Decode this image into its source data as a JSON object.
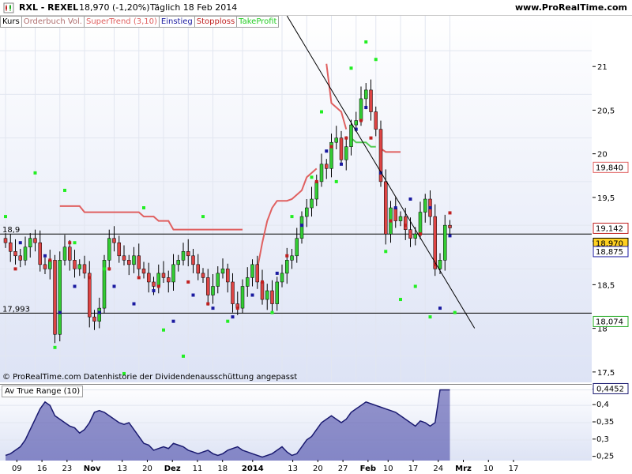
{
  "header": {
    "symbol": "RXL - REXEL",
    "price_change": "18,970 (-1,20%)",
    "period": "Täglich  18 Feb 2014",
    "site": "www.ProRealTime.com"
  },
  "legend": [
    {
      "label": "Kurs",
      "color": "#000000"
    },
    {
      "label": "Orderbuch Vol.",
      "color": "#b07070"
    },
    {
      "label": "SuperTrend (3,10)",
      "color": "#e06060"
    },
    {
      "label": "Einstieg",
      "color": "#1a1aa0"
    },
    {
      "label": "Stopploss",
      "color": "#c02020"
    },
    {
      "label": "TakeProfit",
      "color": "#22cc22"
    }
  ],
  "copyright": "© ProRealTime.com  Datenhistorie der Dividendenausschüttung angepasst",
  "atr_label": "Av True Range (10)",
  "chart_data": [
    {
      "type": "candlestick",
      "y_ticks": [
        "21",
        "20,5",
        "20",
        "19,5",
        "19",
        "18,5",
        "18",
        "17,5"
      ],
      "ylim": [
        17.2,
        21.4
      ],
      "horizontal_lines": [
        {
          "label": "18,9",
          "value": 18.9
        },
        {
          "label": "17,993",
          "value": 17.993
        }
      ],
      "price_tags": [
        {
          "label": "19,840",
          "value": 19.84,
          "color": "#e06060",
          "bg": "#ffffff"
        },
        {
          "label": "19,142",
          "value": 19.142,
          "color": "#c02020",
          "bg": "#ffffff"
        },
        {
          "label": "18,970",
          "value": 18.97,
          "color": "#000000",
          "bg": "#ffd020"
        },
        {
          "label": "18,875",
          "value": 18.875,
          "color": "#1a1aa0",
          "bg": "#ffffff"
        },
        {
          "label": "18,074",
          "value": 18.074,
          "color": "#22aa22",
          "bg": "#ffffff"
        }
      ],
      "x_labels": [
        "09",
        "16",
        "23",
        "Nov",
        "13",
        "20",
        "Dez",
        "11",
        "18",
        "2014",
        "13",
        "20",
        "27",
        "Feb",
        "10",
        "17",
        "24",
        "Mrz",
        "10",
        "17"
      ],
      "x_label_bold": [
        "Nov",
        "Dez",
        "2014",
        "Feb",
        "Mrz"
      ],
      "close": [
        18.8,
        18.7,
        18.65,
        18.6,
        18.75,
        18.85,
        18.8,
        18.55,
        18.5,
        18.6,
        17.75,
        18.6,
        18.75,
        18.6,
        18.5,
        18.55,
        18.45,
        17.95,
        17.9,
        18.05,
        18.6,
        18.85,
        18.8,
        18.65,
        18.6,
        18.55,
        18.65,
        18.5,
        18.45,
        18.35,
        18.3,
        18.45,
        18.4,
        18.35,
        18.55,
        18.6,
        18.7,
        18.65,
        18.55,
        18.45,
        18.4,
        18.2,
        18.3,
        18.45,
        18.5,
        18.35,
        18.1,
        18.05,
        18.3,
        18.4,
        18.55,
        18.35,
        18.15,
        18.25,
        18.1,
        18.35,
        18.45,
        18.6,
        18.65,
        18.85,
        19.1,
        19.2,
        19.3,
        19.5,
        19.7,
        19.65,
        19.95,
        20.0,
        19.75,
        19.9,
        20.15,
        20.2,
        20.45,
        20.55,
        20.3,
        20.1,
        19.5,
        18.9,
        19.2,
        19.05,
        19.1,
        18.95,
        18.85,
        18.9,
        19.15,
        19.3,
        19.1,
        18.5,
        18.6,
        19.0,
        18.97
      ],
      "supertrend": [
        null,
        null,
        null,
        null,
        null,
        null,
        null,
        null,
        null,
        null,
        null,
        19.22,
        19.22,
        19.22,
        19.22,
        19.22,
        19.15,
        19.15,
        19.15,
        19.15,
        19.15,
        19.15,
        19.15,
        19.15,
        19.15,
        19.15,
        19.15,
        19.15,
        19.1,
        19.1,
        19.1,
        19.05,
        19.05,
        19.05,
        18.95,
        18.95,
        18.95,
        18.95,
        18.95,
        18.95,
        18.95,
        18.95,
        18.95,
        18.95,
        18.95,
        18.95,
        18.95,
        18.95,
        18.95,
        null,
        18.1,
        18.5,
        18.8,
        19.05,
        19.2,
        19.28,
        19.28,
        19.28,
        19.3,
        19.35,
        19.4,
        19.55,
        19.6,
        19.65,
        19.7,
        20.85,
        20.4,
        20.35,
        20.3,
        20.1,
        20.0,
        19.95,
        19.95,
        19.95,
        19.9,
        19.9,
        19.88,
        19.84,
        19.84,
        19.84,
        19.84
      ],
      "dots_green": [
        [
          0,
          19.1
        ],
        [
          6,
          19.6
        ],
        [
          10,
          17.6
        ],
        [
          12,
          19.4
        ],
        [
          14,
          18.8
        ],
        [
          20,
          18.5
        ],
        [
          24,
          17.3
        ],
        [
          28,
          19.2
        ],
        [
          32,
          17.8
        ],
        [
          36,
          17.5
        ],
        [
          40,
          19.1
        ],
        [
          45,
          17.9
        ],
        [
          50,
          18.2
        ],
        [
          54,
          18.0
        ],
        [
          58,
          19.1
        ],
        [
          62,
          19.55
        ],
        [
          64,
          20.3
        ],
        [
          67,
          19.5
        ],
        [
          70,
          20.8
        ],
        [
          73,
          21.1
        ],
        [
          75,
          20.9
        ],
        [
          77,
          18.7
        ],
        [
          80,
          18.15
        ],
        [
          83,
          18.3
        ],
        [
          86,
          17.95
        ],
        [
          89,
          17.1
        ],
        [
          91,
          18.0
        ]
      ],
      "dots_blue": [
        [
          3,
          18.8
        ],
        [
          8,
          18.65
        ],
        [
          11,
          18.0
        ],
        [
          14,
          18.3
        ],
        [
          19,
          18.0
        ],
        [
          22,
          18.3
        ],
        [
          26,
          18.1
        ],
        [
          30,
          18.25
        ],
        [
          34,
          17.9
        ],
        [
          38,
          18.2
        ],
        [
          42,
          18.05
        ],
        [
          46,
          17.95
        ],
        [
          50,
          18.2
        ],
        [
          55,
          18.45
        ],
        [
          60,
          19.0
        ],
        [
          65,
          19.85
        ],
        [
          68,
          19.7
        ],
        [
          71,
          20.1
        ],
        [
          73,
          20.35
        ],
        [
          76,
          19.6
        ],
        [
          79,
          19.2
        ],
        [
          82,
          19.3
        ],
        [
          86,
          19.2
        ],
        [
          88,
          18.05
        ],
        [
          90,
          18.88
        ]
      ],
      "dots_red": [
        [
          2,
          18.5
        ],
        [
          9,
          18.6
        ],
        [
          13,
          18.8
        ],
        [
          17,
          18.4
        ],
        [
          21,
          18.5
        ],
        [
          27,
          18.4
        ],
        [
          31,
          18.3
        ],
        [
          37,
          18.35
        ],
        [
          41,
          18.1
        ],
        [
          47,
          18.05
        ],
        [
          52,
          18.35
        ],
        [
          57,
          18.65
        ],
        [
          63,
          19.5
        ],
        [
          66,
          19.9
        ],
        [
          69,
          20.0
        ],
        [
          72,
          20.2
        ],
        [
          74,
          20.0
        ],
        [
          78,
          19.05
        ],
        [
          81,
          19.0
        ],
        [
          84,
          18.9
        ],
        [
          87,
          18.55
        ],
        [
          90,
          19.142
        ]
      ],
      "trendline": {
        "from": [
          57,
          21.4
        ],
        "to": [
          95,
          17.82
        ]
      }
    },
    {
      "type": "area",
      "title": "Av True Range (10)",
      "y_ticks": [
        "0,4452",
        "0,4",
        "0,35",
        "0,3",
        "0,25"
      ],
      "ylim": [
        0.24,
        0.46
      ],
      "values": [
        0.255,
        0.26,
        0.27,
        0.28,
        0.3,
        0.33,
        0.36,
        0.39,
        0.41,
        0.4,
        0.37,
        0.36,
        0.35,
        0.34,
        0.335,
        0.32,
        0.33,
        0.35,
        0.38,
        0.385,
        0.38,
        0.37,
        0.36,
        0.35,
        0.345,
        0.35,
        0.33,
        0.31,
        0.29,
        0.285,
        0.27,
        0.275,
        0.28,
        0.275,
        0.29,
        0.285,
        0.28,
        0.27,
        0.265,
        0.26,
        0.265,
        0.27,
        0.26,
        0.255,
        0.26,
        0.27,
        0.275,
        0.28,
        0.27,
        0.265,
        0.26,
        0.255,
        0.25,
        0.255,
        0.26,
        0.27,
        0.28,
        0.265,
        0.255,
        0.26,
        0.28,
        0.3,
        0.31,
        0.33,
        0.35,
        0.36,
        0.37,
        0.36,
        0.35,
        0.36,
        0.38,
        0.39,
        0.4,
        0.41,
        0.405,
        0.4,
        0.395,
        0.39,
        0.385,
        0.38,
        0.37,
        0.36,
        0.35,
        0.34,
        0.355,
        0.35,
        0.34,
        0.35,
        0.4452,
        0.445,
        0.4452
      ]
    }
  ]
}
